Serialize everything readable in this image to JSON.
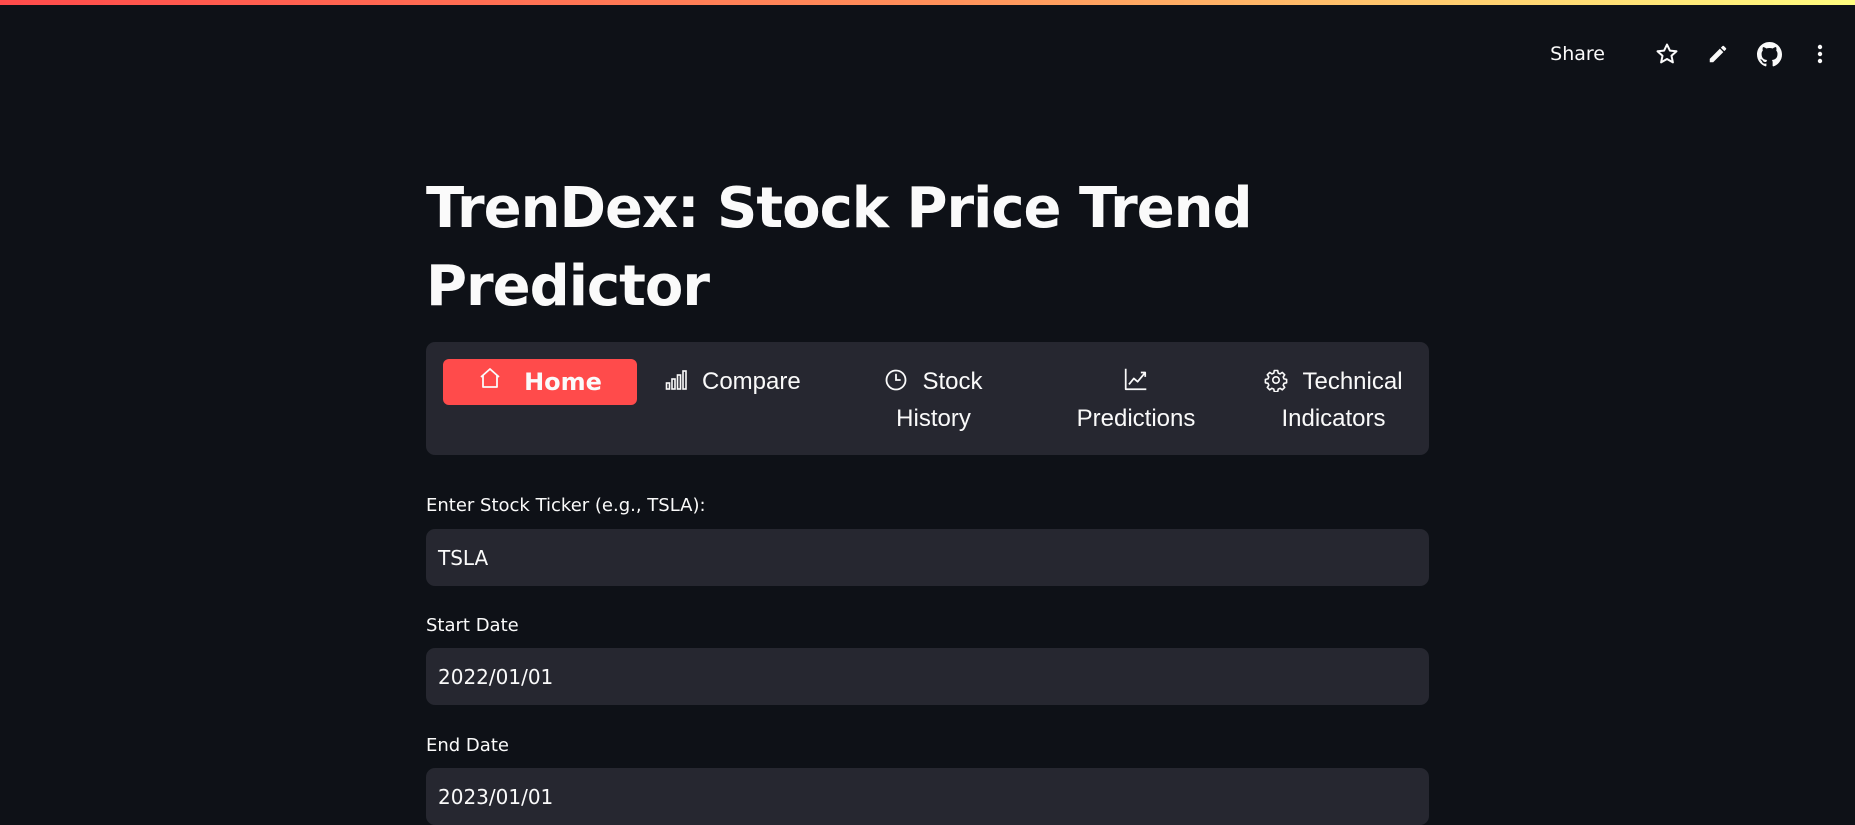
{
  "toolbar": {
    "share_label": "Share",
    "icons": [
      "star-icon",
      "pencil-icon",
      "github-icon",
      "more-vertical-icon"
    ]
  },
  "page": {
    "title": "TrenDex: Stock Price Trend Predictor"
  },
  "nav": {
    "items": [
      {
        "label": "Home",
        "icon": "home-icon",
        "active": true
      },
      {
        "label": "Compare",
        "icon": "bar-chart-icon"
      },
      {
        "label_line1": "Stock",
        "label_line2": "History",
        "icon": "clock-icon"
      },
      {
        "label": "Predictions",
        "icon": "trend-chart-icon"
      },
      {
        "label_line1": "Technical",
        "label_line2": "Indicators",
        "icon": "gear-icon"
      }
    ]
  },
  "form": {
    "ticker": {
      "label": "Enter Stock Ticker (e.g., TSLA):",
      "value": "TSLA"
    },
    "start_date": {
      "label": "Start Date",
      "value": "2022/01/01"
    },
    "end_date": {
      "label": "End Date",
      "value": "2023/01/01"
    }
  },
  "colors": {
    "background": "#0e1117",
    "surface": "#262730",
    "accent": "#ff4b4b",
    "text": "#fafafa"
  }
}
